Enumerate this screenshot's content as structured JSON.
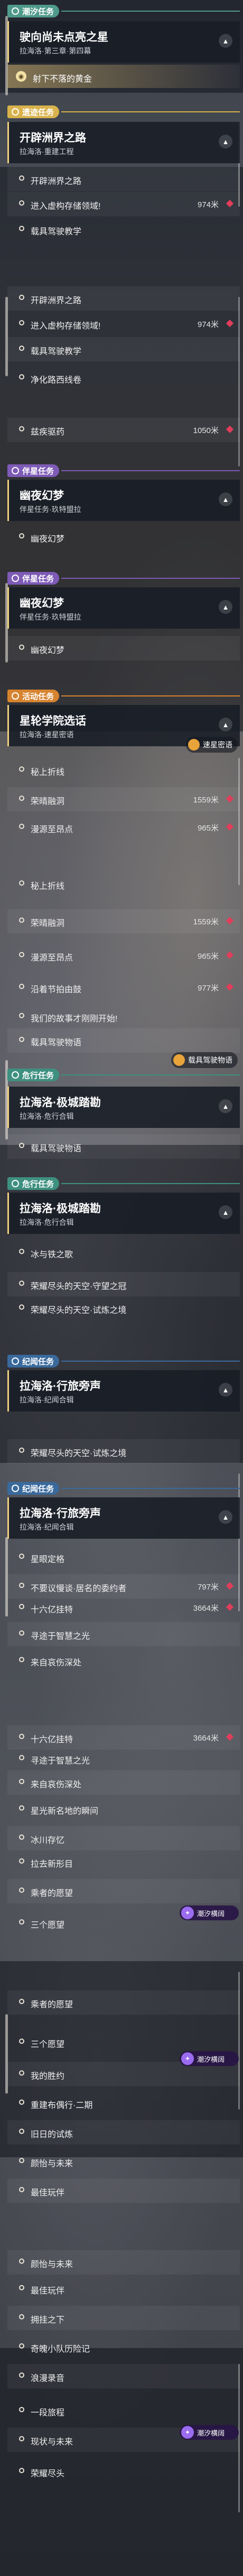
{
  "header_labels": {
    "hs": "潮汐任务",
    "tt": "遗迹任务",
    "bx": "伴星任务",
    "hd": "活动任务",
    "wt": "危行任务",
    "jy": "纪闻任务"
  },
  "tag_colors": {
    "hs": "#4f9a8a",
    "tt": "#d8b24c",
    "bx": "#7e5bb6",
    "hd": "#d6832f",
    "wt": "#3e9080",
    "jy": "#3a6a9c"
  },
  "cards": {
    "c1": {
      "title": "驶向尚未点亮之星",
      "subtitle": "拉海洛·第三章·第四幕"
    },
    "c2": {
      "title": "开辟洲界之路",
      "subtitle": "拉海洛·重建工程"
    },
    "c3": {
      "title": "幽夜幻梦",
      "subtitle": "伴星任务·玖特盟拉"
    },
    "c4": {
      "title": "幽夜幻梦",
      "subtitle": "伴星任务·玖特盟拉"
    },
    "c5": {
      "title": "星轮学院选话",
      "subtitle": "拉海洛·速星密语"
    },
    "c6": {
      "title": "拉海洛·极城踏勘",
      "subtitle": "拉海洛·危行合辑"
    },
    "c7": {
      "title": "拉海洛·极城踏勘",
      "subtitle": "拉海洛·危行合辑"
    },
    "c8": {
      "title": "拉海洛·行旅旁声",
      "subtitle": "拉海洛·纪闻合辑"
    },
    "c9": {
      "title": "拉海洛·行旅旁声",
      "subtitle": "拉海洛·纪闻合辑"
    }
  },
  "golds": {
    "g1": "射下不落的黄金"
  },
  "rows": {
    "r1": {
      "text": "开辟洲界之路",
      "dist": ""
    },
    "r2": {
      "text": "进入虚构存储领域!",
      "dist": "974米"
    },
    "r3": {
      "text": "载具驾驶教学",
      "dist": ""
    },
    "r4": {
      "text": "开辟洲界之路",
      "dist": ""
    },
    "r5": {
      "text": "进入虚构存储领域!",
      "dist": "974米"
    },
    "r6": {
      "text": "载具驾驶教学",
      "dist": ""
    },
    "r7": {
      "text": "净化路西线卷",
      "dist": ""
    },
    "r8": {
      "text": "兹疾驱药",
      "dist": "1050米"
    },
    "r9": {
      "text": "幽夜幻梦",
      "dist": ""
    },
    "r10": {
      "text": "幽夜幻梦",
      "dist": ""
    },
    "r11": {
      "text": "秘上折线",
      "dist": ""
    },
    "r12": {
      "text": "荣晴融洞",
      "dist": "1559米"
    },
    "r13": {
      "text": "漫源至昂点",
      "dist": "965米"
    },
    "r14": {
      "text": "秘上折线",
      "dist": ""
    },
    "r15": {
      "text": "荣晴融洞",
      "dist": "1559米"
    },
    "r16": {
      "text": "漫源至昂点",
      "dist": "965米"
    },
    "r17": {
      "text": "沿着节拍由鼓",
      "dist": "977米"
    },
    "r18": {
      "text": "我们的故事才刚刚开始!",
      "dist": ""
    },
    "r19": {
      "text": "载具驾驶物语",
      "dist": ""
    },
    "r20": {
      "text": "载具驾驶物语",
      "dist": ""
    },
    "r21": {
      "text": "冰与铁之歌",
      "dist": ""
    },
    "r22": {
      "text": "荣耀尽头的天空·守望之冠",
      "dist": ""
    },
    "r23": {
      "text": "荣耀尽头的天空·试炼之境",
      "dist": ""
    },
    "r24": {
      "text": "荣耀尽头的天空·试炼之境",
      "dist": ""
    },
    "r25": {
      "text": "星眼定格",
      "dist": ""
    },
    "r26": {
      "text": "不要议慢谈·居名的委约者",
      "dist": "797米"
    },
    "r27": {
      "text": "十六亿挂特",
      "dist": "3664米"
    },
    "r28": {
      "text": "寻途于智慧之光",
      "dist": ""
    },
    "r29": {
      "text": "来自哀伤深处",
      "dist": ""
    },
    "r30": {
      "text": "十六亿挂特",
      "dist": "3664米"
    },
    "r31": {
      "text": "寻途于智慧之光",
      "dist": ""
    },
    "r32": {
      "text": "来自哀伤深处",
      "dist": ""
    },
    "r33": {
      "text": "星光新名地的瞬间",
      "dist": ""
    },
    "r34": {
      "text": "冰川存忆",
      "dist": ""
    },
    "r35": {
      "text": "拉去新形目",
      "dist": ""
    },
    "r36": {
      "text": "乘者的愿望",
      "dist": ""
    },
    "r37": {
      "text": "三个愿望",
      "dist": ""
    },
    "r38": {
      "text": "乘者的愿望",
      "dist": ""
    },
    "r39": {
      "text": "三个愿望",
      "dist": ""
    },
    "r40": {
      "text": "我的胜约",
      "dist": ""
    },
    "r41": {
      "text": "重建布偶行·二期",
      "dist": ""
    },
    "r42": {
      "text": "旧日的试炼",
      "dist": ""
    },
    "r43": {
      "text": "颜怡与未来",
      "dist": ""
    },
    "r44": {
      "text": "最佳玩伴",
      "dist": ""
    },
    "r45": {
      "text": "颜怡与未来",
      "dist": ""
    },
    "r46": {
      "text": "最佳玩伴",
      "dist": ""
    },
    "r47": {
      "text": "拥挂之下",
      "dist": ""
    },
    "r48": {
      "text": "奇魄小队历险记",
      "dist": ""
    },
    "r49": {
      "text": "浪漫录音",
      "dist": ""
    },
    "r50": {
      "text": "一段旅程",
      "dist": ""
    },
    "r51": {
      "text": "现状与未来",
      "dist": ""
    },
    "r52": {
      "text": "荣耀尽头",
      "dist": ""
    }
  },
  "badges": {
    "b": "潮汐横阔"
  },
  "tips": {
    "t1": "速星密语",
    "t2": "载具驾驶物语"
  }
}
